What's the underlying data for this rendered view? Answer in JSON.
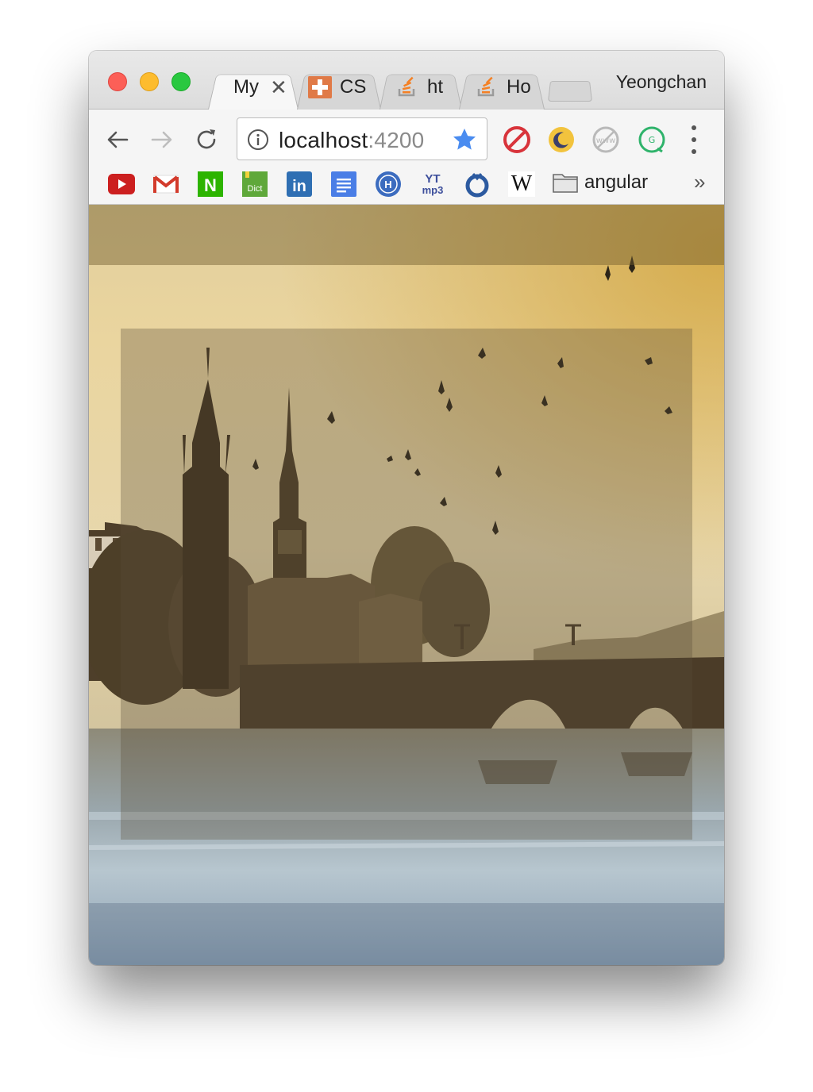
{
  "window": {
    "tabs": [
      {
        "label": "My",
        "active": true
      },
      {
        "label": "CS",
        "active": false
      },
      {
        "label": "ht",
        "active": false
      },
      {
        "label": "Ho",
        "active": false
      }
    ],
    "profile_name": "Yeongchan"
  },
  "toolbar": {
    "url_host": "localhost",
    "url_port": ":4200",
    "icons": [
      "back-arrow-icon",
      "forward-arrow-icon",
      "reload-icon",
      "info-icon",
      "bookmark-star-icon",
      "adblock-icon",
      "night-mode-icon",
      "www-blocked-icon",
      "grammar-extension-icon",
      "menu-dots-icon"
    ]
  },
  "bookmarks": {
    "items": [
      "youtube-icon",
      "gmail-icon",
      "naver-icon",
      "dict-icon",
      "linkedin-icon",
      "docs-icon",
      "university-icon",
      "ytmp3-icon",
      "ring-icon",
      "wikipedia-icon"
    ],
    "dict_label": "Dict",
    "ytmp3_top": "YT",
    "ytmp3_bottom": "mp3",
    "wiki_label": "W",
    "naver_label": "N",
    "linkedin_label": "in",
    "folder_label": "angular",
    "more_label": "»"
  },
  "colors": {
    "sky_top": "#efd9a2",
    "sky_warm": "#d8b25c",
    "water": "#8fa3b3",
    "overlay": "#7a6a4f"
  }
}
